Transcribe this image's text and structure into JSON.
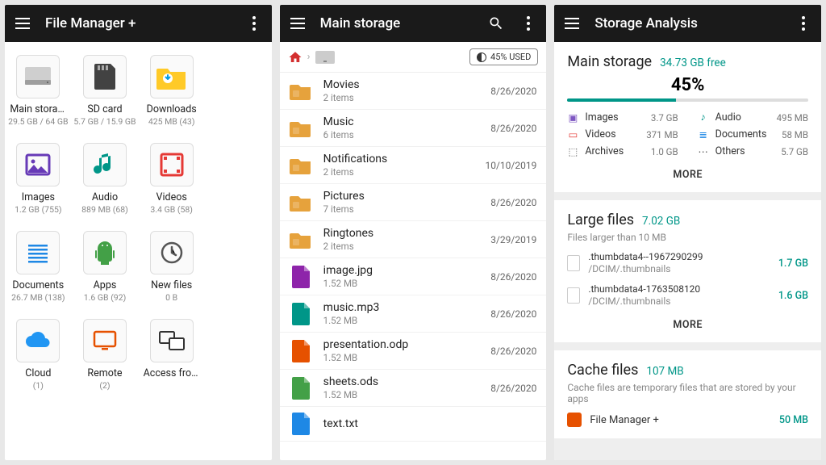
{
  "panel1": {
    "title": "File Manager +",
    "tiles": [
      {
        "label": "Main storage",
        "sub": "29.5 GB / 64 GB",
        "icon": "drive",
        "color": "#9e9e9e"
      },
      {
        "label": "SD card",
        "sub": "5.7 GB / 15.9 GB",
        "icon": "sdcard",
        "color": "#424242"
      },
      {
        "label": "Downloads",
        "sub": "425 MB (43)",
        "icon": "download",
        "color": "#039be5"
      },
      {
        "label": "",
        "sub": "",
        "icon": "",
        "color": ""
      },
      {
        "label": "Images",
        "sub": "1.2 GB (755)",
        "icon": "image",
        "color": "#673ab7"
      },
      {
        "label": "Audio",
        "sub": "889 MB (68)",
        "icon": "audio",
        "color": "#009688"
      },
      {
        "label": "Videos",
        "sub": "3.4 GB (58)",
        "icon": "video",
        "color": "#e53935"
      },
      {
        "label": "",
        "sub": "",
        "icon": "",
        "color": ""
      },
      {
        "label": "Documents",
        "sub": "26.7 MB (138)",
        "icon": "document",
        "color": "#1e88e5"
      },
      {
        "label": "Apps",
        "sub": "1.6 GB (92)",
        "icon": "android",
        "color": "#43a047"
      },
      {
        "label": "New files",
        "sub": "0 B",
        "icon": "clock",
        "color": "#555"
      },
      {
        "label": "",
        "sub": "",
        "icon": "",
        "color": ""
      },
      {
        "label": "Cloud",
        "sub": "(1)",
        "icon": "cloud",
        "color": "#2196f3"
      },
      {
        "label": "Remote",
        "sub": "(2)",
        "icon": "monitor",
        "color": "#e65100"
      },
      {
        "label": "Access from…",
        "sub": "",
        "icon": "cast",
        "color": "#333"
      },
      {
        "label": "",
        "sub": "",
        "icon": "",
        "color": ""
      }
    ]
  },
  "panel2": {
    "title": "Main storage",
    "used_badge": "45% USED",
    "items": [
      {
        "name": "Movies",
        "meta": "2 items",
        "date": "8/26/2020",
        "type": "folder",
        "color": "#e6a23c"
      },
      {
        "name": "Music",
        "meta": "6 items",
        "date": "8/26/2020",
        "type": "folder",
        "color": "#e6a23c"
      },
      {
        "name": "Notifications",
        "meta": "2 items",
        "date": "10/10/2019",
        "type": "folder",
        "color": "#e6a23c"
      },
      {
        "name": "Pictures",
        "meta": "7 items",
        "date": "8/26/2020",
        "type": "folder",
        "color": "#e6a23c"
      },
      {
        "name": "Ringtones",
        "meta": "2 items",
        "date": "3/29/2019",
        "type": "folder",
        "color": "#e6a23c"
      },
      {
        "name": "image.jpg",
        "meta": "1.52 MB",
        "date": "8/26/2020",
        "type": "file",
        "color": "#8e24aa"
      },
      {
        "name": "music.mp3",
        "meta": "1.52 MB",
        "date": "8/26/2020",
        "type": "file",
        "color": "#009688"
      },
      {
        "name": "presentation.odp",
        "meta": "1.52 MB",
        "date": "8/26/2020",
        "type": "file",
        "color": "#e65100"
      },
      {
        "name": "sheets.ods",
        "meta": "1.52 MB",
        "date": "8/26/2020",
        "type": "file",
        "color": "#43a047"
      },
      {
        "name": "text.txt",
        "meta": "",
        "date": "",
        "type": "file",
        "color": "#1e88e5"
      }
    ]
  },
  "panel3": {
    "title": "Storage Analysis",
    "main": {
      "heading": "Main storage",
      "free": "34.73 GB free",
      "pct_label": "45%",
      "pct_value": 45,
      "cats": [
        {
          "name": "Images",
          "val": "3.7 GB",
          "color": "#7e57c2"
        },
        {
          "name": "Audio",
          "val": "495 MB",
          "color": "#009688"
        },
        {
          "name": "Videos",
          "val": "371 MB",
          "color": "#e53935"
        },
        {
          "name": "Documents",
          "val": "58 MB",
          "color": "#1e88e5"
        },
        {
          "name": "Archives",
          "val": "1.0 GB",
          "color": "#555"
        },
        {
          "name": "Others",
          "val": "5.7 GB",
          "color": "#555"
        }
      ],
      "more": "MORE"
    },
    "large": {
      "heading": "Large files",
      "size": "7.02 GB",
      "sub": "Files larger than 10 MB",
      "files": [
        {
          "name": ".thumbdata4--1967290299",
          "path": "/DCIM/.thumbnails",
          "size": "1.7 GB"
        },
        {
          "name": ".thumbdata4-1763508120",
          "path": "/DCIM/.thumbnails",
          "size": "1.6 GB"
        }
      ],
      "more": "MORE"
    },
    "cache": {
      "heading": "Cache files",
      "size": "107 MB",
      "sub": "Cache files are temporary files that are stored by your apps",
      "app_name": "File Manager +",
      "app_size": "50 MB"
    }
  }
}
